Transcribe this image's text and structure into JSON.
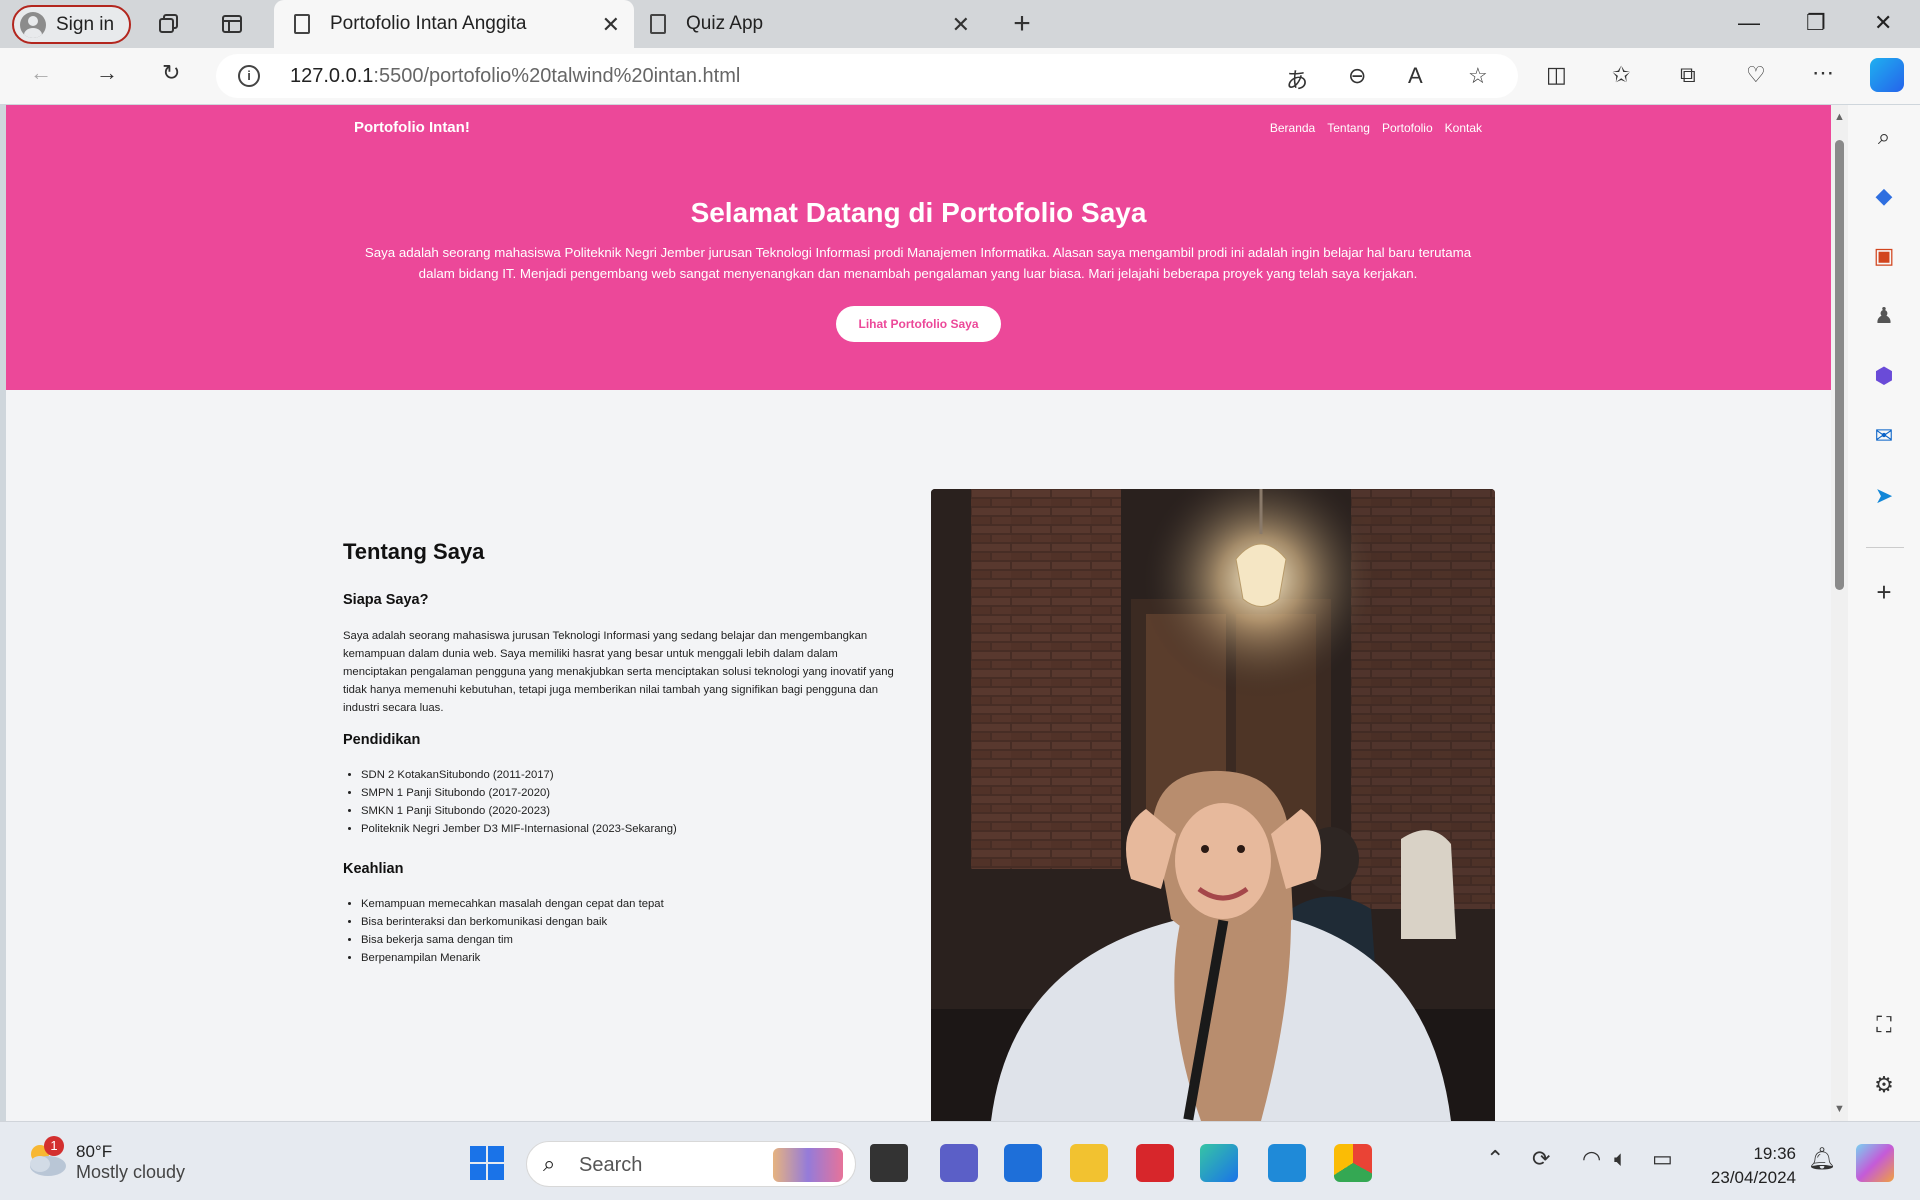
{
  "browser": {
    "signin_label": "Sign in",
    "tabs": [
      {
        "title": "Portofolio Intan Anggita",
        "active": true
      },
      {
        "title": "Quiz App",
        "active": false
      }
    ],
    "new_tab_label": "+",
    "url_host": "127.0.0.1",
    "url_path": ":5500/portofolio%20talwind%20intan.html"
  },
  "page": {
    "brand": "Portofolio Intan!",
    "nav": [
      "Beranda",
      "Tentang",
      "Portofolio",
      "Kontak"
    ],
    "hero_title": "Selamat Datang di Portofolio Saya",
    "hero_text": "Saya adalah seorang mahasiswa Politeknik Negri Jember jurusan Teknologi Informasi prodi Manajemen Informatika. Alasan saya mengambil prodi ini adalah ingin belajar hal baru terutama dalam bidang IT. Menjadi pengembang web sangat menyenangkan dan menambah pengalaman yang luar biasa. Mari jelajahi beberapa proyek yang telah saya kerjakan.",
    "cta_label": "Lihat Portofolio Saya",
    "about_title": "Tentang Saya",
    "who_title": "Siapa Saya?",
    "who_text": "Saya adalah seorang mahasiswa jurusan Teknologi Informasi yang sedang belajar dan mengembangkan kemampuan dalam dunia web. Saya memiliki hasrat yang besar untuk menggali lebih dalam dalam menciptakan pengalaman pengguna yang menakjubkan serta menciptakan solusi teknologi yang inovatif yang tidak hanya memenuhi kebutuhan, tetapi juga memberikan nilai tambah yang signifikan bagi pengguna dan industri secara luas.",
    "edu_title": "Pendidikan",
    "education": [
      "SDN 2 KotakanSitubondo (2011-2017)",
      "SMPN 1 Panji Situbondo (2017-2020)",
      "SMKN 1 Panji Situbondo (2020-2023)",
      "Politeknik Negri Jember D3 MIF-Internasional (2023-Sekarang)"
    ],
    "skills_title": "Keahlian",
    "skills": [
      "Kemampuan memecahkan masalah dengan cepat dan tepat",
      "Bisa berinteraksi dan berkomunikasi dengan baik",
      "Bisa bekerja sama dengan tim",
      "Berpenampilan Menarik"
    ]
  },
  "taskbar": {
    "weather_temp": "80°F",
    "weather_cond": "Mostly cloudy",
    "weather_badge": "1",
    "search_label": "Search",
    "time": "19:36",
    "date": "23/04/2024"
  },
  "colors": {
    "accent": "#ec4899",
    "page_bg": "#f3f4f6"
  }
}
